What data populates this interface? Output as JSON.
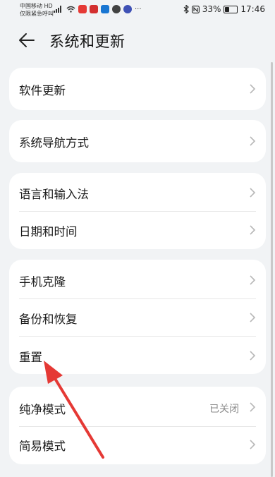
{
  "status_bar": {
    "carrier_line1": "中国移动 HD",
    "carrier_line2": "仅限紧急呼叫",
    "battery": "33%",
    "battery_level": 0.33,
    "time": "17:46"
  },
  "header": {
    "title": "系统和更新"
  },
  "groups": [
    {
      "items": [
        {
          "label": "软件更新",
          "value": ""
        }
      ]
    },
    {
      "items": [
        {
          "label": "系统导航方式",
          "value": ""
        }
      ]
    },
    {
      "items": [
        {
          "label": "语言和输入法",
          "value": ""
        },
        {
          "label": "日期和时间",
          "value": ""
        }
      ]
    },
    {
      "items": [
        {
          "label": "手机克隆",
          "value": ""
        },
        {
          "label": "备份和恢复",
          "value": ""
        },
        {
          "label": "重置",
          "value": ""
        }
      ]
    },
    {
      "items": [
        {
          "label": "纯净模式",
          "value": "已关闭"
        },
        {
          "label": "简易模式",
          "value": ""
        }
      ]
    }
  ],
  "colors": {
    "accent_arrow": "#e53935",
    "card": "#ffffff",
    "background": "#f1f3f5"
  }
}
